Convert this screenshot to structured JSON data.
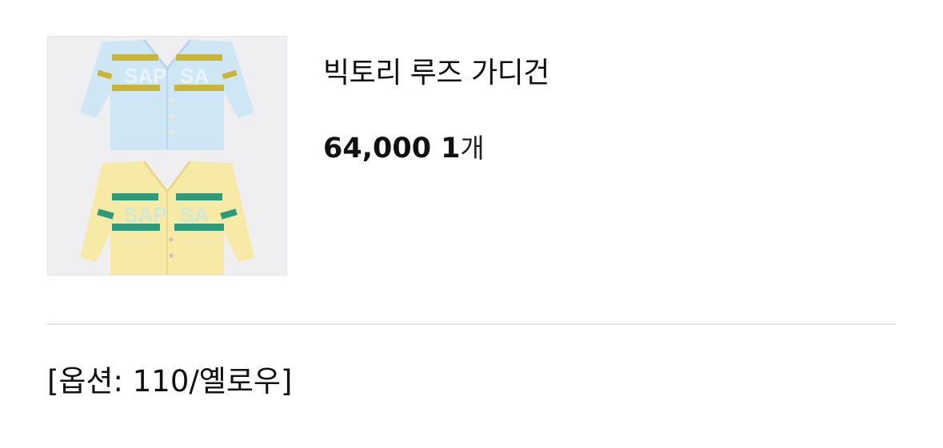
{
  "product": {
    "image_alt": "cardigan-image",
    "title": "빅토리 루즈 가디건",
    "price": "64,000",
    "quantity": "1",
    "quantity_unit": "개"
  },
  "option": {
    "text": "[옵션: 110/옐로우]"
  },
  "colors": {
    "thumb_bg": "#efeff1",
    "sky_blue": "#cfe6f5",
    "mustard": "#c9b43a",
    "yellow": "#f7eaa6",
    "green": "#2e9a7c",
    "divider": "#e4e4e4"
  }
}
